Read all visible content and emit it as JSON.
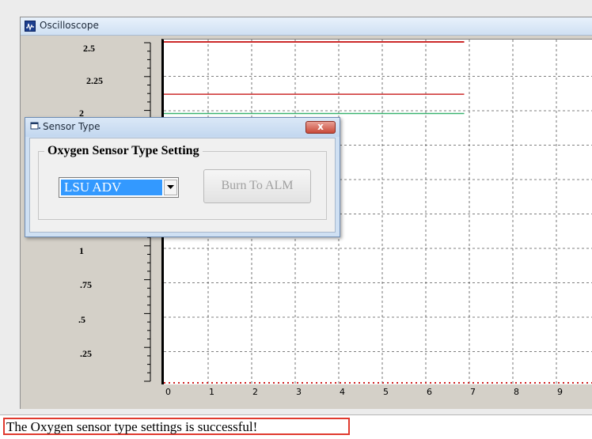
{
  "window": {
    "title": "Oscilloscope",
    "icon": "oscilloscope-icon"
  },
  "y_axis": {
    "ticks": [
      "2.5",
      "2.25",
      "2",
      "1",
      ".75",
      ".5",
      ".25"
    ]
  },
  "x_axis": {
    "ticks": [
      "0",
      "1",
      "2",
      "3",
      "4",
      "5",
      "6",
      "7",
      "8",
      "9"
    ]
  },
  "traces": [
    {
      "color": "#cc2a2a",
      "level": 2.5,
      "x_end": 6.9
    },
    {
      "color": "#cc2a2a",
      "level": 2.12,
      "x_end": 6.9
    },
    {
      "color": "#3cb371",
      "level": 1.98,
      "x_end": 6.9
    }
  ],
  "dialog": {
    "title": "Sensor Type",
    "group_title": "Oxygen Sensor Type Setting",
    "select_value": "LSU ADV",
    "burn_button": "Burn To ALM",
    "close_label": "x"
  },
  "status": {
    "message": "The Oxygen sensor type settings is successful!"
  },
  "colors": {
    "grid": "#555555",
    "plot_background": "#ffffff",
    "status_highlight": "#e03a2e",
    "selection": "#3399ff"
  }
}
